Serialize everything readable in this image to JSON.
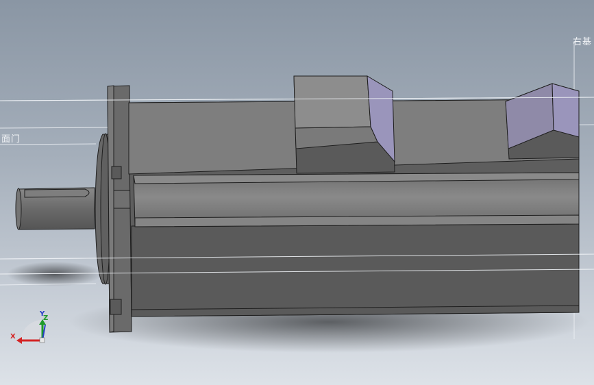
{
  "viewport": {
    "background_top": "#8a96a4",
    "background_bottom": "#dde2e8"
  },
  "model": {
    "description_icons": [
      "servo-motor-body",
      "motor-shaft",
      "connector-box-1",
      "connector-box-2",
      "mounting-flange"
    ],
    "colors": {
      "body": "#5c5c5c",
      "body_top": "#7f7f7f",
      "flange": "#6a6a6a",
      "connector_face": "#8d8d8d",
      "connector_side": "#9a95bb",
      "shaft": "#6f6f6f",
      "edge": "#1e1e1e",
      "channel": "#747474"
    }
  },
  "plane_labels": {
    "right": "右基",
    "left": "面门"
  },
  "triad": {
    "x_label": "X",
    "y_label": "Y",
    "z_label": "Z",
    "x_color": "#d42424",
    "y_color": "#2a3fc9",
    "z_color": "#1f9a2a"
  }
}
